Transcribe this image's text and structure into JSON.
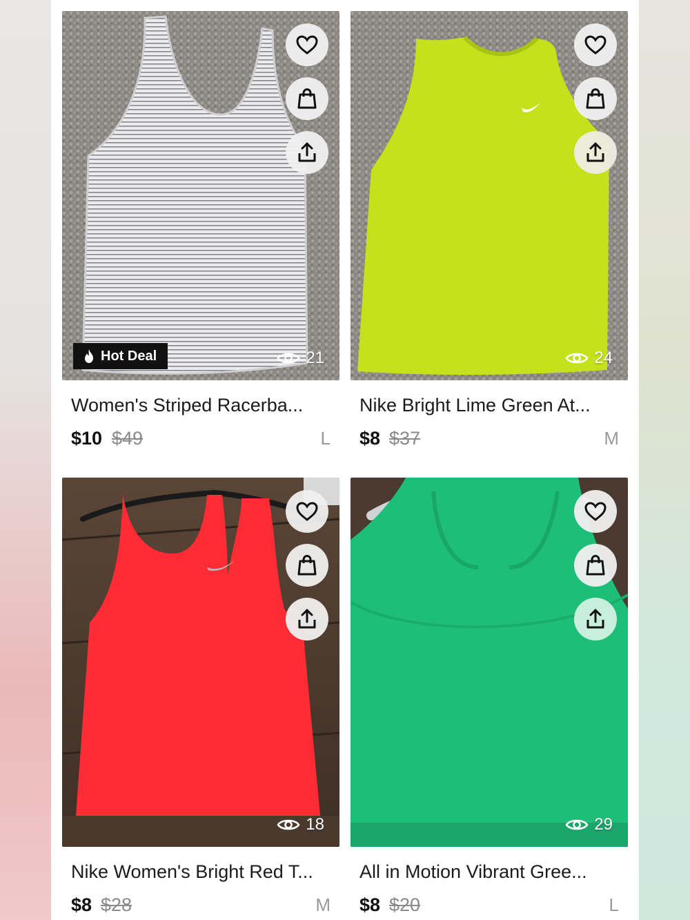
{
  "listings": [
    {
      "title": "Women's Striped Racerba...",
      "price": "$10",
      "original_price": "$49",
      "size": "L",
      "views": "21",
      "badge": "Hot Deal",
      "item_color": "#d6d6d6"
    },
    {
      "title": "Nike Bright Lime Green At...",
      "price": "$8",
      "original_price": "$37",
      "size": "M",
      "views": "24",
      "item_color": "#c2e21a"
    },
    {
      "title": "Nike Women's Bright Red T...",
      "price": "$8",
      "original_price": "$28",
      "size": "M",
      "views": "18",
      "item_color": "#ff2f3c"
    },
    {
      "title": "All in Motion Vibrant Gree...",
      "price": "$8",
      "original_price": "$20",
      "size": "L",
      "views": "29",
      "item_color": "#1fc078"
    }
  ],
  "icons": {
    "like": "heart-icon",
    "cart": "shopping-bag-icon",
    "share": "share-icon",
    "views": "eye-icon",
    "badge": "flame-icon"
  }
}
